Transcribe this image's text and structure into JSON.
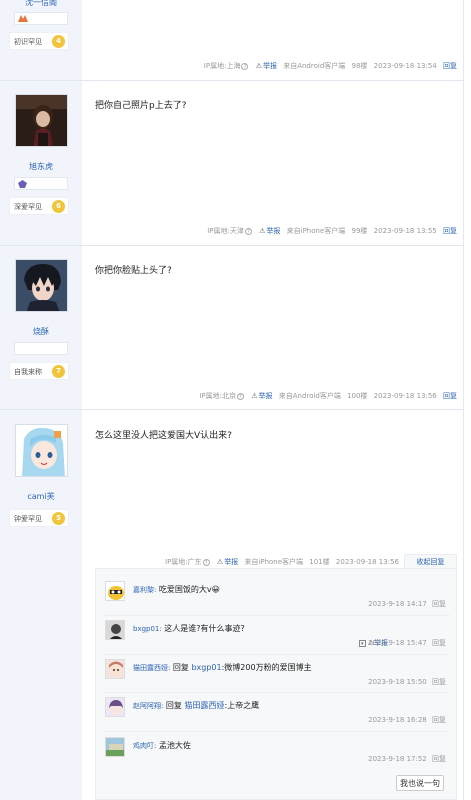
{
  "posts": [
    {
      "username": "沈一信阁",
      "level_title": "初识罕见",
      "level": "4",
      "meta": {
        "ip_label": "IP属地:上海",
        "report": "举报",
        "client": "来自Android客户端",
        "floor": "98楼",
        "time": "2023-09-18 13:54",
        "reply": "回复"
      }
    },
    {
      "username": "旭东虎",
      "content": "把你自己照片p上去了?",
      "level_title": "深爱罕见",
      "level": "6",
      "meta": {
        "ip_label": "IP属地:天津",
        "report": "举报",
        "client": "来自iPhone客户端",
        "floor": "99楼",
        "time": "2023-09-18 13:55",
        "reply": "回复"
      }
    },
    {
      "username": "烧酥",
      "content": "你把你脸贴上头了?",
      "level_title": "自我来称",
      "level": "7",
      "meta": {
        "ip_label": "IP属地:北京",
        "report": "举报",
        "client": "来自Android客户端",
        "floor": "100楼",
        "time": "2023-09-18 13:56",
        "reply": "回复"
      }
    },
    {
      "username": "cami芙",
      "content": "怎么这里没人把这爱国大V认出来?",
      "level_title": "钟爱罕见",
      "level": "5",
      "meta": {
        "ip_label": "IP属地:广东",
        "report": "举报",
        "client": "来自iPhone客户端",
        "floor": "101楼",
        "time": "2023-09-18 13:56",
        "collapse": "收起回复"
      }
    }
  ],
  "sub_replies": [
    {
      "user": "嘉利黎:",
      "text": "吃爱国饭的大v",
      "emoji": "😀",
      "time": "2023-9-18 14:17",
      "reply": "回复"
    },
    {
      "user": "bxgp01:",
      "text": "这人是谁?有什么事迹?",
      "time": "2023-9-18 15:47",
      "reply": "回复",
      "report": "举报"
    },
    {
      "user": "猫田露西娅:",
      "prefix": "回复",
      "target": "bxgp01",
      "text": ":微博200万粉的爱国博主",
      "time": "2023-9-18 15:50",
      "reply": "回复"
    },
    {
      "user": "赵阿阿翔:",
      "prefix": "回复",
      "target": "猫田露西娅",
      "text": ":上帝之鹰",
      "time": "2023-9-18 16:28",
      "reply": "回复"
    },
    {
      "user": "鸡肉叮:",
      "text": "孟池大佐",
      "time": "2023-9-18 17:52",
      "reply": "回复"
    }
  ],
  "reply_button": "我也说一句",
  "colors": {
    "link": "#2d64b3",
    "sidebar": "#f1f5fb",
    "level_badge": "#f2c43c"
  }
}
